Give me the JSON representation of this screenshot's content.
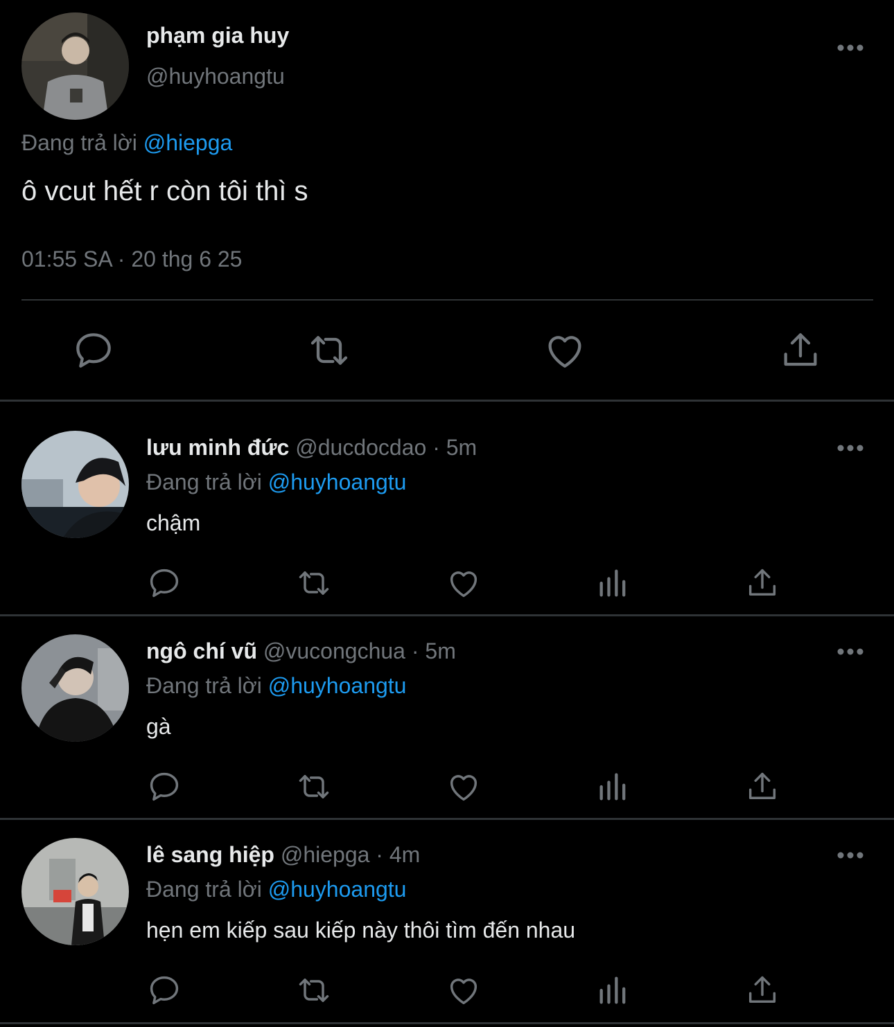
{
  "main_tweet": {
    "author_name": "phạm gia huy",
    "author_handle": "@huyhoangtu",
    "replying_label": "Đang trả lời",
    "replying_to": "@hiepga",
    "text": "ô vcut hết r còn tôi thì s",
    "timestamp": "01:55 SA · 20 thg 6 25",
    "actions": [
      "reply-icon",
      "retweet-icon",
      "like-icon",
      "share-icon"
    ]
  },
  "replies": [
    {
      "author_name": "lưu minh đức",
      "author_handle": "@ducdocdao",
      "time": "· 5m",
      "replying_label": "Đang trả lời",
      "replying_to": "@huyhoangtu",
      "text": "chậm"
    },
    {
      "author_name": "ngô chí vũ",
      "author_handle": "@vucongchua",
      "time": "· 5m",
      "replying_label": "Đang trả lời",
      "replying_to": "@huyhoangtu",
      "text": "gà"
    },
    {
      "author_name": "lê sang hiệp",
      "author_handle": "@hiepga",
      "time": "· 4m",
      "replying_label": "Đang trả lời",
      "replying_to": "@huyhoangtu",
      "text": "hẹn em kiếp sau kiếp này thôi tìm đến nhau"
    }
  ],
  "reply_actions": [
    "reply-icon",
    "retweet-icon",
    "like-icon",
    "views-icon",
    "share-icon"
  ],
  "colors": {
    "background": "#000000",
    "text": "#e7e9ea",
    "secondary": "#71767b",
    "link": "#1d9bf0",
    "divider": "#2f3336"
  }
}
